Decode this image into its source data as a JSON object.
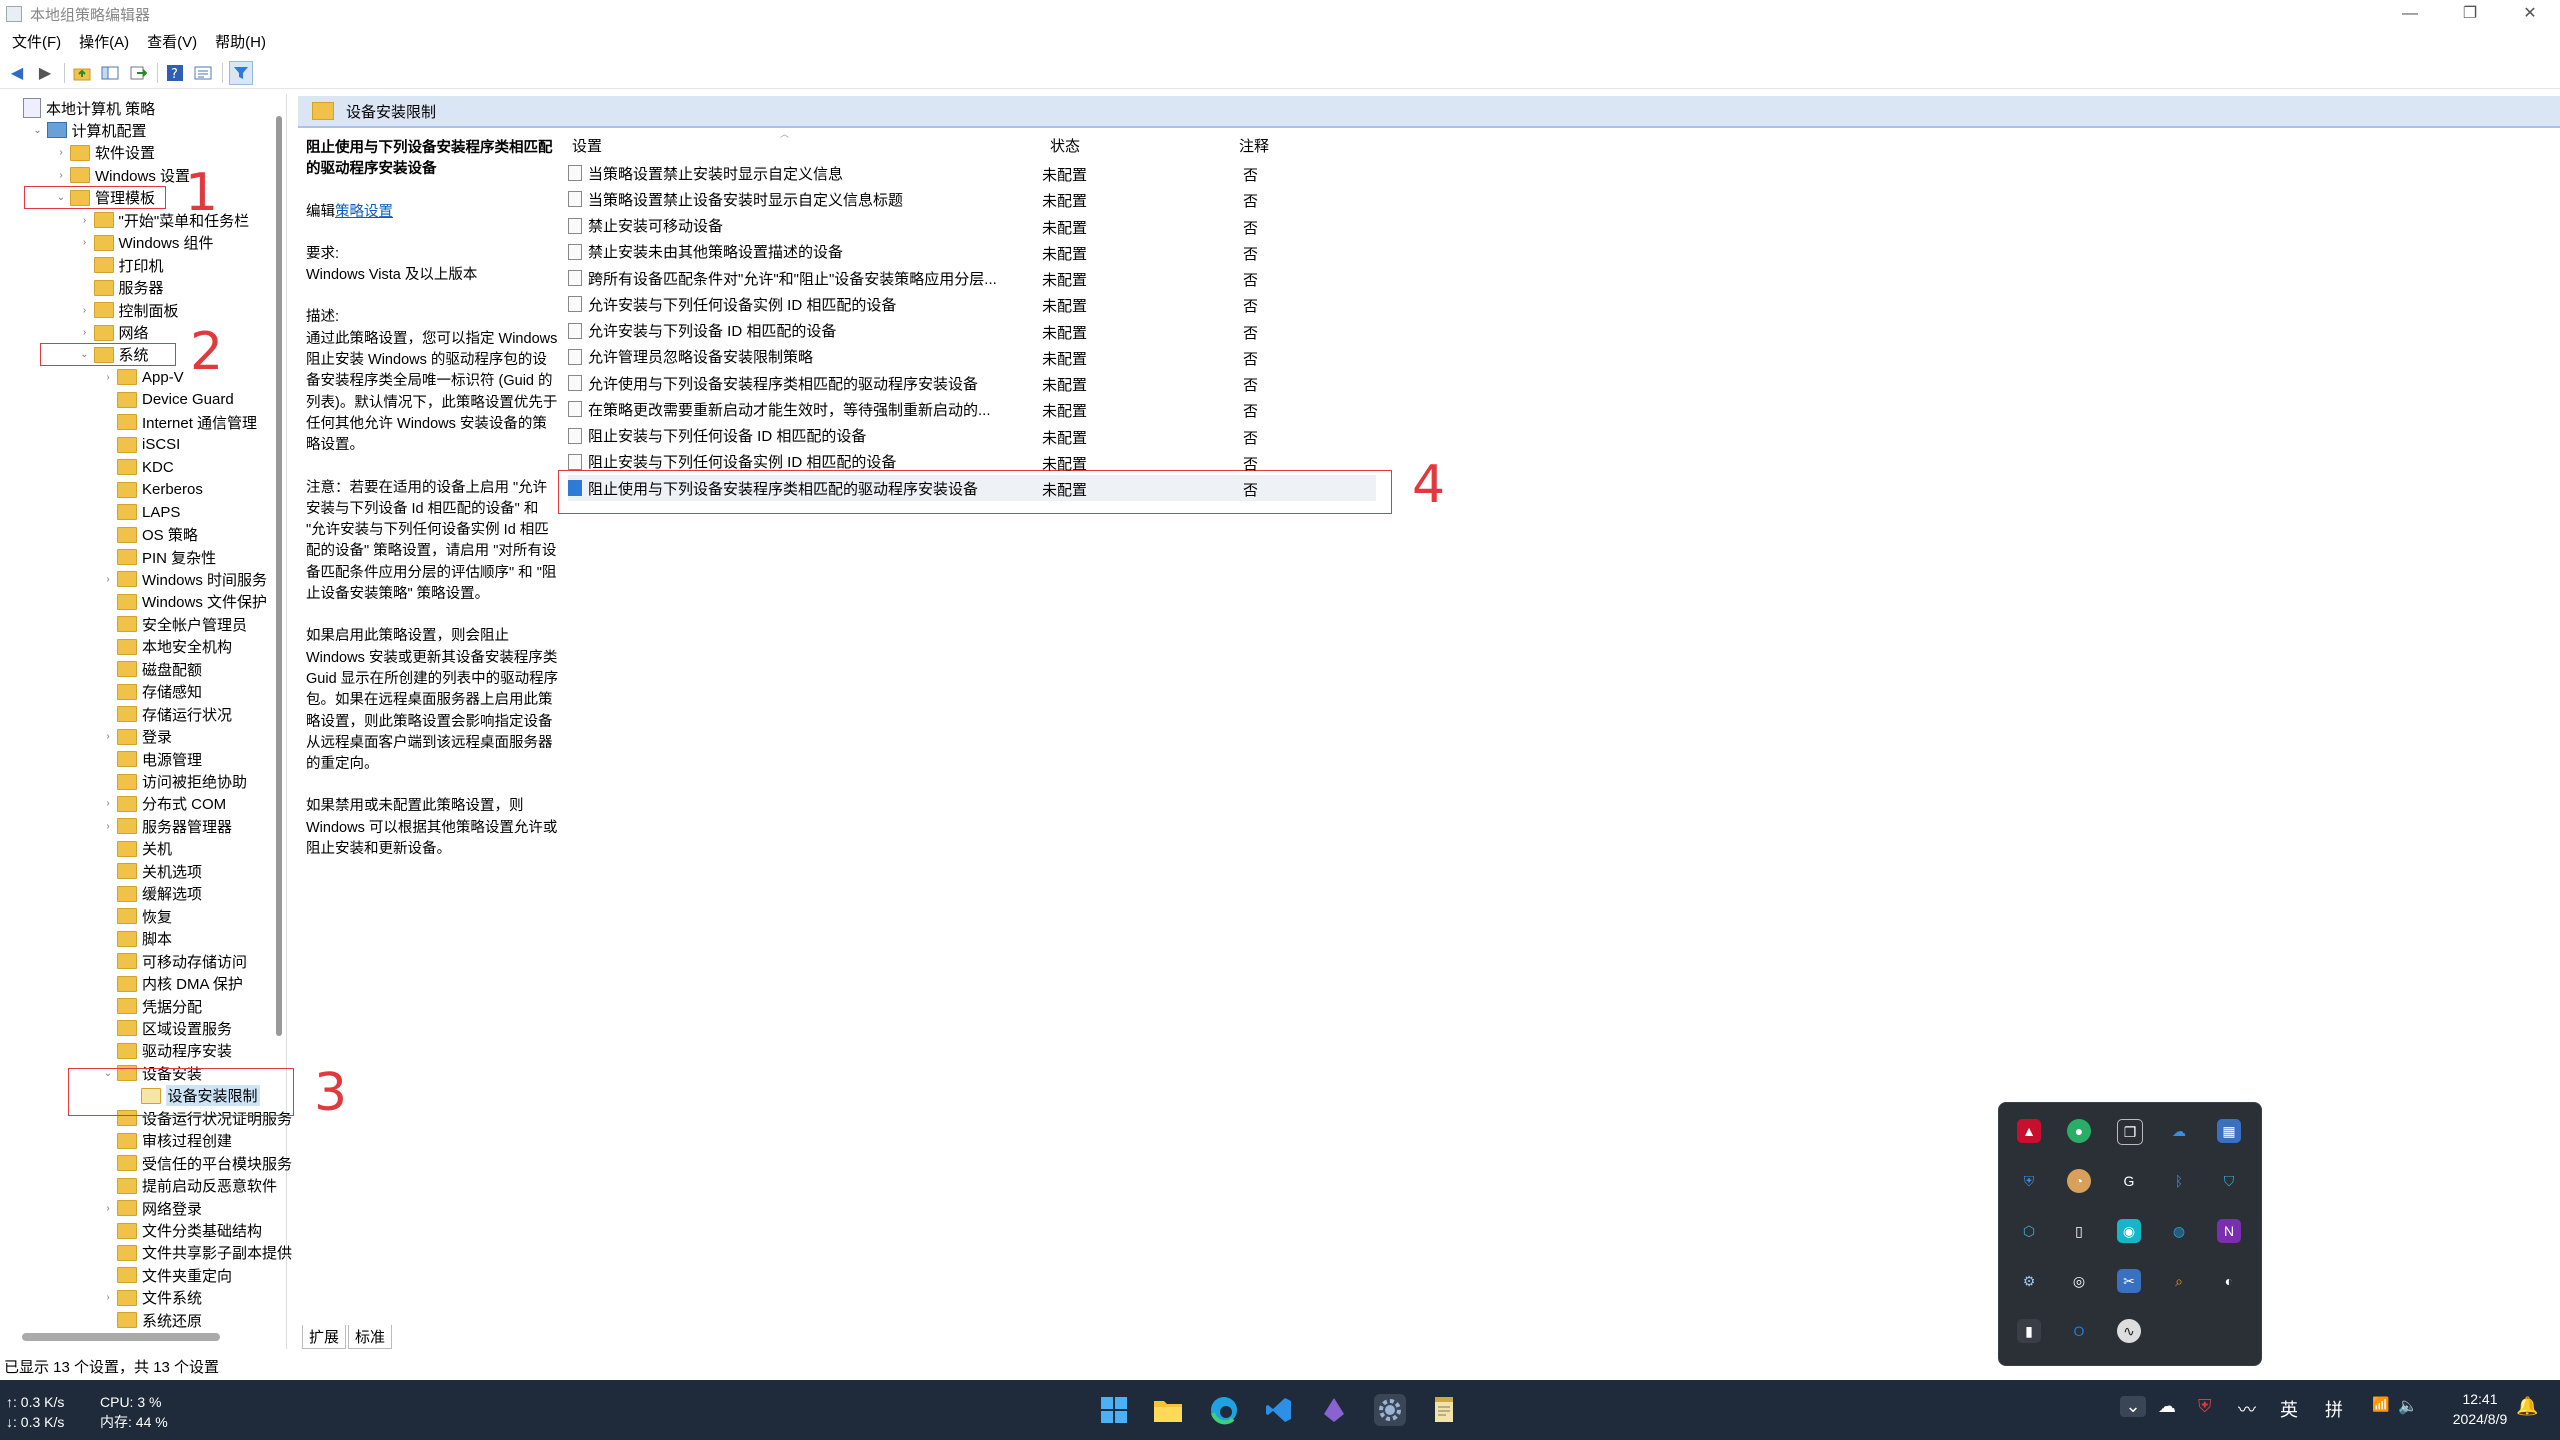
{
  "window": {
    "title": "本地组策略编辑器",
    "controls": [
      "—",
      "❐",
      "✕"
    ]
  },
  "menu": [
    "文件(F)",
    "操作(A)",
    "查看(V)",
    "帮助(H)"
  ],
  "tree": {
    "root": "本地计算机 策略",
    "computer": "计算机配置",
    "software": "软件设置",
    "windows_settings": "Windows 设置",
    "admin_templates": "管理模板",
    "start_menu": "\"开始\"菜单和任务栏",
    "windows_components": "Windows 组件",
    "printers": "打印机",
    "server": "服务器",
    "control_panel": "控制面板",
    "network": "网络",
    "system": "系统",
    "system_children": [
      "App-V",
      "Device Guard",
      "Internet 通信管理",
      "iSCSI",
      "KDC",
      "Kerberos",
      "LAPS",
      "OS 策略",
      "PIN 复杂性",
      "Windows 时间服务",
      "Windows 文件保护",
      "安全帐户管理员",
      "本地安全机构",
      "磁盘配额",
      "存储感知",
      "存储运行状况",
      "登录",
      "电源管理",
      "访问被拒绝协助",
      "分布式 COM",
      "服务器管理器",
      "关机",
      "关机选项",
      "缓解选项",
      "恢复",
      "脚本",
      "可移动存储访问",
      "内核 DMA 保护",
      "凭据分配",
      "区域设置服务",
      "驱动程序安装"
    ],
    "device_install": "设备安装",
    "device_install_restrictions": "设备安装限制",
    "after_children": [
      "设备运行状况证明服务",
      "审核过程创建",
      "受信任的平台模块服务",
      "提前启动反恶意软件",
      "网络登录",
      "文件分类基础结构",
      "文件共享影子副本提供",
      "文件夹重定向",
      "文件系统",
      "系统还原"
    ]
  },
  "annotations": [
    "1",
    "2",
    "3",
    "4"
  ],
  "header": {
    "title": "设备安装限制"
  },
  "description": {
    "title": "阻止使用与下列设备安装程序类相匹配的驱动程序安装设备",
    "edit_prefix": "编辑",
    "edit_link": "策略设置",
    "req_label": "要求:",
    "req_value": "Windows Vista 及以上版本",
    "desc_label": "描述:",
    "desc_text": "通过此策略设置，您可以指定 Windows 阻止安装 Windows 的驱动程序包的设备安装程序类全局唯一标识符 (Guid 的列表)。默认情况下，此策略设置优先于任何其他允许 Windows 安装设备的策略设置。",
    "note_text": "注意：若要在适用的设备上启用 \"允许安装与下列设备 Id 相匹配的设备\" 和 \"允许安装与下列任何设备实例 Id 相匹配的设备\" 策略设置，请启用 \"对所有设备匹配条件应用分层的评估顺序\" 和 \"阻止设备安装策略\" 策略设置。",
    "enabled_text": "如果启用此策略设置，则会阻止 Windows 安装或更新其设备安装程序类 Guid 显示在所创建的列表中的驱动程序包。如果在远程桌面服务器上启用此策略设置，则此策略设置会影响指定设备从远程桌面客户端到该远程桌面服务器的重定向。",
    "disabled_text": "如果禁用或未配置此策略设置，则 Windows 可以根据其他策略设置允许或阻止安装和更新设备。"
  },
  "columns": {
    "setting": "设置",
    "state": "状态",
    "comment": "注释"
  },
  "rows": [
    {
      "name": "当策略设置禁止安装时显示自定义信息",
      "state": "未配置",
      "comment": "否"
    },
    {
      "name": "当策略设置禁止设备安装时显示自定义信息标题",
      "state": "未配置",
      "comment": "否"
    },
    {
      "name": "禁止安装可移动设备",
      "state": "未配置",
      "comment": "否"
    },
    {
      "name": "禁止安装未由其他策略设置描述的设备",
      "state": "未配置",
      "comment": "否"
    },
    {
      "name": "跨所有设备匹配条件对\"允许\"和\"阻止\"设备安装策略应用分层...",
      "state": "未配置",
      "comment": "否"
    },
    {
      "name": "允许安装与下列任何设备实例 ID 相匹配的设备",
      "state": "未配置",
      "comment": "否"
    },
    {
      "name": "允许安装与下列设备 ID 相匹配的设备",
      "state": "未配置",
      "comment": "否"
    },
    {
      "name": "允许管理员忽略设备安装限制策略",
      "state": "未配置",
      "comment": "否"
    },
    {
      "name": "允许使用与下列设备安装程序类相匹配的驱动程序安装设备",
      "state": "未配置",
      "comment": "否"
    },
    {
      "name": "在策略更改需要重新启动才能生效时，等待强制重新启动的...",
      "state": "未配置",
      "comment": "否"
    },
    {
      "name": "阻止安装与下列任何设备 ID 相匹配的设备",
      "state": "未配置",
      "comment": "否"
    },
    {
      "name": "阻止安装与下列任何设备实例 ID 相匹配的设备",
      "state": "未配置",
      "comment": "否"
    },
    {
      "name": "阻止使用与下列设备安装程序类相匹配的驱动程序安装设备",
      "state": "未配置",
      "comment": "否"
    }
  ],
  "tabs": [
    "扩展",
    "标准"
  ],
  "status": "已显示 13 个设置，共 13 个设置",
  "taskbar": {
    "net_up": "↑: 0.3 K/s",
    "net_down": "↓: 0.3 K/s",
    "cpu": "CPU: 3 %",
    "mem": "内存: 44 %",
    "ime1": "英",
    "ime2": "拼",
    "time": "12:41",
    "date": "2024/8/9"
  },
  "colors": {
    "accent": "#2f7ad6",
    "annotation": "#e0393e",
    "taskbar": "#1f2b3a"
  }
}
